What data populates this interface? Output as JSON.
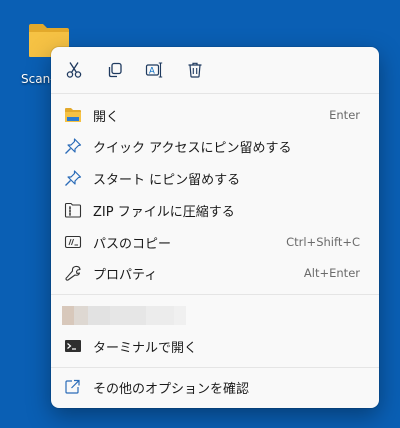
{
  "desktop": {
    "folder_label": "Scan-"
  },
  "quick_actions": [
    {
      "name": "cut",
      "icon": "scissors-icon"
    },
    {
      "name": "copy",
      "icon": "copy-icon"
    },
    {
      "name": "rename",
      "icon": "rename-icon"
    },
    {
      "name": "delete",
      "icon": "trash-icon"
    }
  ],
  "menu": {
    "open": {
      "label": "開く",
      "shortcut": "Enter",
      "icon": "folder-open-icon"
    },
    "pin_quick_access": {
      "label": "クイック アクセスにピン留めする",
      "icon": "pin-icon"
    },
    "pin_start": {
      "label": "スタート にピン留めする",
      "icon": "pin-icon"
    },
    "compress_zip": {
      "label": "ZIP ファイルに圧縮する",
      "icon": "zip-icon"
    },
    "copy_path": {
      "label": "パスのコピー",
      "shortcut": "Ctrl+Shift+C",
      "icon": "path-icon"
    },
    "properties": {
      "label": "プロパティ",
      "shortcut": "Alt+Enter",
      "icon": "wrench-icon"
    },
    "open_terminal": {
      "label": "ターミナルで開く",
      "icon": "terminal-icon"
    },
    "more_options": {
      "label": "その他のオプションを確認",
      "icon": "external-link-icon"
    }
  },
  "colors": {
    "desktop_bg": "#0a5fb4",
    "menu_bg": "#f9f9f9",
    "accent": "#0067c0",
    "folder": "#f6c244"
  }
}
